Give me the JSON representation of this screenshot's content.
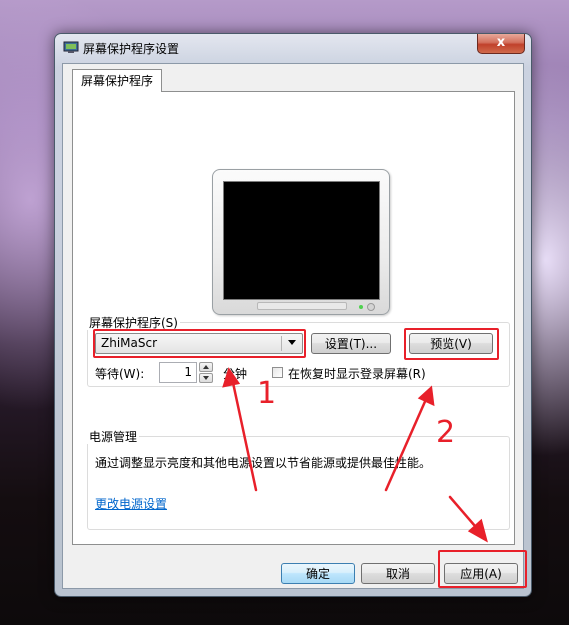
{
  "window": {
    "title": "屏幕保护程序设置",
    "close_label": "x"
  },
  "tab": {
    "label": "屏幕保护程序"
  },
  "screensaver": {
    "group_label": "屏幕保护程序(S)",
    "selected": "ZhiMaScr",
    "settings_button": "设置(T)...",
    "preview_button": "预览(V)",
    "wait_label": "等待(W):",
    "wait_value": "1",
    "minutes_label": "分钟",
    "resume_checkbox_label": "在恢复时显示登录屏幕(R)",
    "resume_checked": false
  },
  "power": {
    "group_label": "电源管理",
    "description": "通过调整显示亮度和其他电源设置以节省能源或提供最佳性能。",
    "link": "更改电源设置"
  },
  "footer": {
    "ok_button": "确定",
    "cancel_button": "取消",
    "apply_button": "应用(A)"
  },
  "annotations": {
    "label_1": "1",
    "label_2": "2",
    "color": "#e8202a"
  }
}
